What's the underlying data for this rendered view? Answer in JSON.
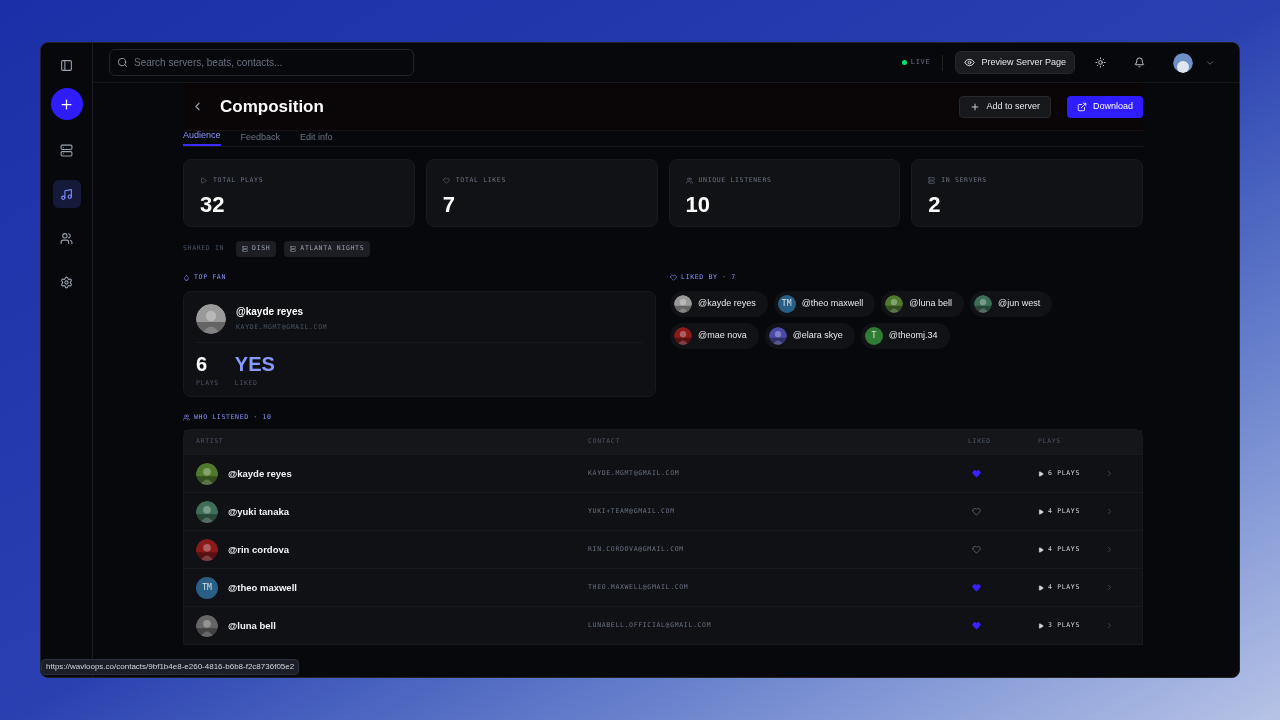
{
  "topbar": {
    "search": {
      "placeholder": "Search servers, beats, contacts..."
    },
    "live": {
      "label": "LIVE",
      "on": true
    },
    "preview_button": "Preview Server Page"
  },
  "sidebar": {
    "items": [
      {
        "selected": false
      },
      {
        "selected": true
      },
      {
        "selected": false
      },
      {
        "selected": false
      }
    ]
  },
  "header": {
    "title": "Composition",
    "buttons": [
      {
        "label": "Add to server",
        "kind": "secondary"
      },
      {
        "label": "Download",
        "kind": "primary"
      }
    ]
  },
  "tabs": [
    {
      "label": "Audience",
      "selected": true
    },
    {
      "label": "Feedback",
      "selected": false
    },
    {
      "label": "Edit info",
      "selected": false
    }
  ],
  "stats": [
    {
      "label": "TOTAL PLAYS",
      "value": "32"
    },
    {
      "label": "TOTAL LIKES",
      "value": "7"
    },
    {
      "label": "UNIQUE LISTENERS",
      "value": "10"
    },
    {
      "label": "IN SERVERS",
      "value": "2"
    }
  ],
  "shared_in": {
    "label": "SHARED IN",
    "servers": [
      "DISH",
      "ATLANTA NIGHTS"
    ]
  },
  "top_fan": {
    "label": "TOP FAN",
    "name": "@kayde reyes",
    "email": "KAYDE.MGMT@GMAIL.COM",
    "plays": "6",
    "plays_label": "PLAYS",
    "liked": "YES",
    "liked_label": "LIKED"
  },
  "liked_by": {
    "label": "LIKED BY · 7",
    "users": [
      {
        "name": "@kayde reyes"
      },
      {
        "name": "@theo maxwell",
        "kind": "initials",
        "initials": "TM",
        "color": "#2a5f85"
      },
      {
        "name": "@luna bell"
      },
      {
        "name": "@jun west"
      },
      {
        "name": "@mae nova"
      },
      {
        "name": "@elara skye"
      },
      {
        "name": "@theomj.34",
        "kind": "initials",
        "initials": "T",
        "color": "#2e7d32"
      }
    ]
  },
  "who_listened": {
    "label": "WHO LISTENED · 10",
    "columns": [
      "ARTIST",
      "CONTACT",
      "LIKED",
      "PLAYS"
    ],
    "rows": [
      {
        "name": "@kayde reyes",
        "contact": "KAYDE.MGMT@GMAIL.COM",
        "liked": true,
        "plays": "6 PLAYS"
      },
      {
        "name": "@yuki tanaka",
        "contact": "YUKI+TEAM@GMAIL.COM",
        "liked": false,
        "plays": "4 PLAYS"
      },
      {
        "name": "@rin cordova",
        "contact": "RIN.CORDOVA@GMAIL.COM",
        "liked": false,
        "plays": "4 PLAYS"
      },
      {
        "name": "@theo maxwell",
        "kind": "initials",
        "initials": "TM",
        "color": "#2a5f85",
        "contact": "THEO.MAXWELL@GMAIL.COM",
        "liked": true,
        "plays": "4 PLAYS"
      },
      {
        "name": "@luna bell",
        "contact": "LUNABELL.OFFICIAL@GMAIL.COM",
        "liked": true,
        "plays": "3 PLAYS"
      }
    ]
  },
  "status_url": "https://wavloops.co/contacts/9bf1b4e8-e260-4816-b6b8-f2c8736f05e2"
}
